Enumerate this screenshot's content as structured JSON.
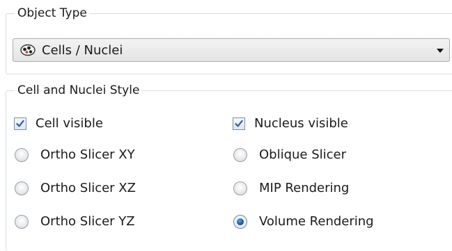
{
  "object_type": {
    "title": "Object Type",
    "selected": "Cells / Nuclei",
    "icon": "cells-nuclei-icon"
  },
  "style": {
    "title": "Cell and Nuclei Style",
    "cell_visible": {
      "label": "Cell visible",
      "checked": true
    },
    "nucleus_visible": {
      "label": "Nucleus visible",
      "checked": true
    },
    "render_modes": [
      {
        "label": "Ortho Slicer XY",
        "selected": false
      },
      {
        "label": "Oblique Slicer",
        "selected": false
      },
      {
        "label": "Ortho Slicer XZ",
        "selected": false
      },
      {
        "label": "MIP Rendering",
        "selected": false
      },
      {
        "label": "Ortho Slicer YZ",
        "selected": false
      },
      {
        "label": "Volume Rendering",
        "selected": true
      }
    ]
  },
  "colors": {
    "group_border": "#d5dfe5",
    "check_blue": "#2c5fa8",
    "radio_selected": "#1c57a8"
  }
}
